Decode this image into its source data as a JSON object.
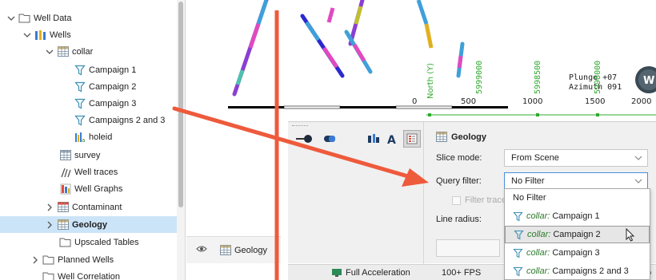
{
  "tree": {
    "items": [
      {
        "label": "Well Data",
        "icon": "folder-icon",
        "chevron": "down"
      },
      {
        "label": "Wells",
        "icon": "wells-icon",
        "chevron": "down"
      },
      {
        "label": "collar",
        "icon": "table-icon",
        "chevron": "down"
      },
      {
        "label": "Campaign 1",
        "icon": "filter-icon"
      },
      {
        "label": "Campaign 2",
        "icon": "filter-icon"
      },
      {
        "label": "Campaign 3",
        "icon": "filter-icon"
      },
      {
        "label": "Campaigns 2 and 3",
        "icon": "filter-icon"
      },
      {
        "label": "holeid",
        "icon": "holeid-icon"
      },
      {
        "label": "survey",
        "icon": "table-icon"
      },
      {
        "label": "Well traces",
        "icon": "well-traces-icon"
      },
      {
        "label": "Well Graphs",
        "icon": "well-graphs-icon"
      },
      {
        "label": "Contaminant",
        "icon": "interval-table-icon",
        "chevron": "right"
      },
      {
        "label": "Geology",
        "icon": "table-icon",
        "chevron": "right",
        "selected": true
      },
      {
        "label": "Upscaled Tables",
        "icon": "folder-icon"
      },
      {
        "label": "Planned Wells",
        "icon": "folder-icon",
        "chevron": "right"
      },
      {
        "label": "Well Correlation",
        "icon": "folder-icon"
      }
    ]
  },
  "scene": {
    "scale_labels": [
      "0",
      "500",
      "1000",
      "1500",
      "2000"
    ],
    "north_label": "North (Y)",
    "grid_labels": [
      "5999000",
      "5998500",
      "5998000"
    ],
    "plunge_label": "Plunge +07",
    "azimuth_label": "Azimuth 091",
    "compass_label": "W"
  },
  "objbar": {
    "label": "Geology"
  },
  "props": {
    "title": "Geology",
    "slice_mode_label": "Slice mode:",
    "slice_mode_value": "From Scene",
    "query_filter_label": "Query filter:",
    "query_filter_value": "No Filter",
    "filter_traces_label": "Filter trace",
    "line_radius_label": "Line radius:"
  },
  "dropdown": {
    "options": [
      {
        "table": "",
        "name": "No Filter"
      },
      {
        "table": "collar:",
        "name": "Campaign 1"
      },
      {
        "table": "collar:",
        "name": "Campaign 2"
      },
      {
        "table": "collar:",
        "name": "Campaign 3"
      },
      {
        "table": "collar:",
        "name": "Campaigns 2 and 3"
      }
    ]
  },
  "status": {
    "acceleration": "Full Acceleration",
    "fps": "100+ FPS",
    "trailing": "o"
  },
  "colors": {
    "annotation_red": "#ee5a3c",
    "selection_blue": "#cce4f7",
    "filter_green": "#2c7a2c"
  }
}
